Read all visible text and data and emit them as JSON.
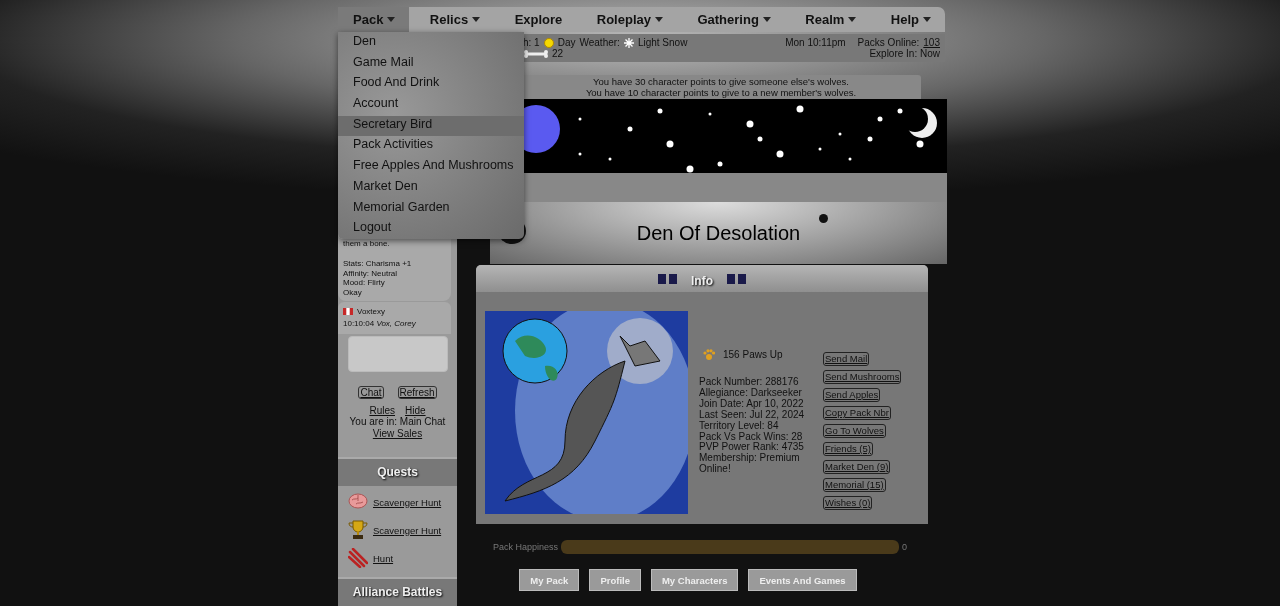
{
  "nav": [
    {
      "label": "Pack",
      "caret": true,
      "selected": true
    },
    {
      "label": "Relics",
      "caret": true,
      "selected": false
    },
    {
      "label": "Explore",
      "caret": false,
      "selected": false
    },
    {
      "label": "Roleplay",
      "caret": true,
      "selected": false
    },
    {
      "label": "Gathering",
      "caret": true,
      "selected": false
    },
    {
      "label": "Realm",
      "caret": true,
      "selected": false
    },
    {
      "label": "Help",
      "caret": true,
      "selected": false
    }
  ],
  "dropdown": [
    {
      "label": "Den",
      "selected": false
    },
    {
      "label": "Game Mail",
      "selected": false
    },
    {
      "label": "Food And Drink",
      "selected": false
    },
    {
      "label": "Account",
      "selected": false
    },
    {
      "label": "Secretary Bird",
      "selected": true
    },
    {
      "label": "Pack Activities",
      "selected": false
    },
    {
      "label": "Free Apples And Mushrooms",
      "selected": false
    },
    {
      "label": "Market Den",
      "selected": false
    },
    {
      "label": "Memorial Garden",
      "selected": false
    },
    {
      "label": "Logout",
      "selected": false
    }
  ],
  "status": {
    "moon": "h: 1",
    "daytime": "Day",
    "weather_label": "Weather:",
    "weather": "Light Snow",
    "bones": "22",
    "time": "Mon 10:11pm",
    "packs_online_label": "Packs Online:",
    "packs_online": "103",
    "explore": "Explore In: Now"
  },
  "notices": [
    "You have 30 character points to give someone else's wolves.",
    "You have 10 character points to give to a new member's wolves."
  ],
  "den_title": "Den Of Desolation",
  "sidebar": {
    "bio": "them a bone.",
    "stats": [
      "Stats: Charisma +1",
      "Affinity: Neutral",
      "Mood: Flirty",
      "Okay"
    ],
    "chat_user": "Voxtexy",
    "chat_message": "10:10:04 *Vox, Corey*",
    "chat_buttons": [
      "Chat",
      "Refresh"
    ],
    "chat_links": [
      "Rules",
      "Hide"
    ],
    "location": "You are in: Main Chat",
    "view_sales": "View Sales"
  },
  "quests": {
    "title": "Quests",
    "items": [
      {
        "label": "Scavenger Hunt"
      },
      {
        "label": "Scavenger Hunt"
      },
      {
        "label": "Hunt"
      }
    ]
  },
  "alliance": {
    "title": "Alliance Battles"
  },
  "info": {
    "title": "Info",
    "paws": "156 Paws Up",
    "details": [
      "Pack Number:  288176",
      "Allegiance: Darkseeker",
      "Join Date: Apr 10, 2022",
      "Last Seen: Jul 22, 2024",
      "Territory Level: 84",
      "Pack Vs Pack Wins: 28",
      "PVP Power Rank: 4735",
      "Membership: Premium",
      "Online!"
    ],
    "actions": [
      "Send Mail",
      "Send Mushrooms",
      "Send Apples",
      "Copy Pack Nbr",
      "Go To Wolves",
      "Friends (5)",
      "Market Den (9)",
      "Memorial (15)",
      "Wishes (0)"
    ]
  },
  "happiness": {
    "label": "Pack Happiness",
    "level": 1,
    "reading": "0"
  },
  "tabs": [
    "My Pack",
    "Profile",
    "My Characters",
    "Events And Games"
  ]
}
